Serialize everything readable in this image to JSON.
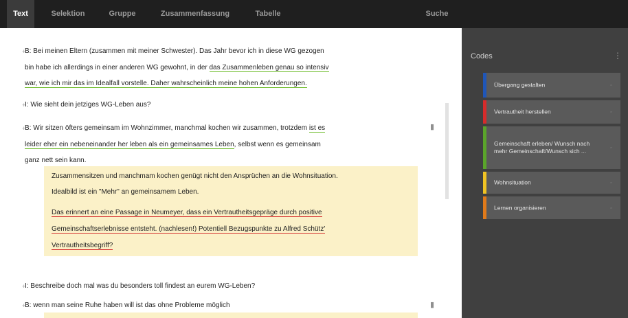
{
  "tabs": [
    {
      "label": "Text",
      "active": true
    },
    {
      "label": "Selektion",
      "active": false
    },
    {
      "label": "Gruppe",
      "active": false
    },
    {
      "label": "Zusammenfassung",
      "active": false
    },
    {
      "label": "Tabelle",
      "active": false
    },
    {
      "label": "Suche",
      "active": false
    }
  ],
  "codes": {
    "title": "Codes",
    "menu_icon": "more-icon",
    "items": [
      {
        "label": "Übergang gestalten",
        "color": "#1f56b8"
      },
      {
        "label": "Vertrautheit herstellen",
        "color": "#d62b2b"
      },
      {
        "label": "Gemeinschaft erleben/ Wunsch nach mehr Gemeinschaft/Wunsch sich ...",
        "color": "#5aa52a"
      },
      {
        "label": "Wohnsituation",
        "color": "#f0c323"
      },
      {
        "label": "Lernen organisieren",
        "color": "#e07a1a"
      }
    ]
  },
  "text": {
    "p1": {
      "a": "B: Bei meinen Eltern (zusammen mit meiner Schwester). Das Jahr bevor ich in diese WG gezogen",
      "b1": "bin habe ich allerdings in einer anderen WG gewohnt, in der ",
      "b2": "das Zusammenleben genau so intensiv",
      "c": "war, wie ich mir das im Idealfall vorstelle. Daher wahrscheinlich meine hohen Anforderungen."
    },
    "p2": "I: Wie sieht dein jetziges WG-Leben aus?",
    "p3": {
      "a1": "B: Wir sitzen öfters gemeinsam im Wohnzimmer, manchmal kochen wir zusammen, trotzdem ",
      "a2": "ist es",
      "b1": "leider eher ein nebeneinander her leben als ein gemeinsames Leben",
      "b2": ", selbst wenn es gemeinsam",
      "c": "ganz nett sein kann."
    },
    "memo1": {
      "a": "Zusammensitzen und manchmam kochen genügt nicht den Ansprüchen an die Wohnsituation.",
      "b": "Idealbild ist ein \"Mehr\" an gemeinsamem Leben.",
      "c": "Das erinnert an eine Passage in Neumeyer, dass ein Vertrautheitsgepräge durch positive",
      "d": "Gemeinschaftserlebnisse entsteht. (nachlesen!) Potentiell Bezugspunkte zu Alfred Schütz'",
      "e": "Vertrautheitsbegriff?"
    },
    "p4": "I: Beschreibe doch mal was du besonders toll findest an eurem WG-Leben?",
    "p5": "B: wenn man seine Ruhe haben will ist das ohne Probleme möglich"
  }
}
